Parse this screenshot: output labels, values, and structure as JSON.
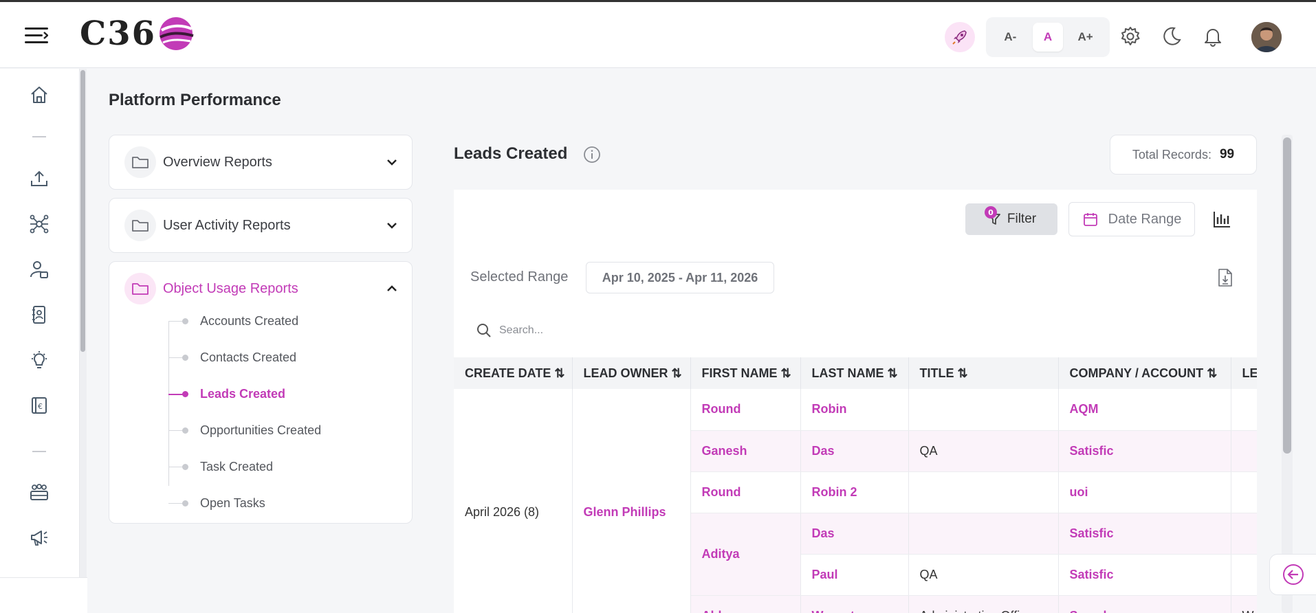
{
  "header": {
    "logo_text": "C36",
    "font_sizes": [
      "A-",
      "A",
      "A+"
    ],
    "active_font_size": "A"
  },
  "page": {
    "title": "Platform Performance"
  },
  "reports_menu": [
    {
      "label": "Overview Reports",
      "expanded": false
    },
    {
      "label": "User Activity Reports",
      "expanded": false
    },
    {
      "label": "Object Usage Reports",
      "expanded": true,
      "items": [
        {
          "label": "Accounts Created",
          "active": false
        },
        {
          "label": "Contacts Created",
          "active": false
        },
        {
          "label": "Leads Created",
          "active": true
        },
        {
          "label": "Opportunities Created",
          "active": false
        },
        {
          "label": "Task Created",
          "active": false
        },
        {
          "label": "Open Tasks",
          "active": false
        }
      ]
    }
  ],
  "report": {
    "title": "Leads Created",
    "total_label": "Total Records:",
    "total_value": "99",
    "filter_label": "Filter",
    "filter_count": "0",
    "date_range_label": "Date Range",
    "selected_range_label": "Selected Range",
    "selected_range_value": "Apr 10, 2025 - Apr 11, 2026",
    "search_placeholder": "Search..."
  },
  "table": {
    "columns": [
      "CREATE DATE",
      "LEAD OWNER",
      "FIRST NAME",
      "LAST NAME",
      "TITLE",
      "COMPANY / ACCOUNT",
      "LE"
    ],
    "group": {
      "create_date": "April 2026 (8)",
      "lead_owner": "Glenn Phillips"
    },
    "rows": [
      {
        "first_name": "Round",
        "last_name": "Robin",
        "title": "",
        "company": "AQM",
        "extra": ""
      },
      {
        "first_name": "Ganesh",
        "last_name": "Das",
        "title": "QA",
        "company": "Satisfic",
        "extra": ""
      },
      {
        "first_name": "Round",
        "last_name": "Robin 2",
        "title": "",
        "company": "uoi",
        "extra": ""
      },
      {
        "first_name": "Aditya",
        "last_name": "Das",
        "title": "",
        "company": "Satisfic",
        "extra": ""
      },
      {
        "first_name": "",
        "last_name": "Paul",
        "title": "QA",
        "company": "Satisfic",
        "extra": ""
      },
      {
        "first_name": "Abhe",
        "last_name": "Waveet",
        "title": "Administrative Officer",
        "company": "Sample",
        "extra": "W"
      }
    ]
  },
  "colors": {
    "accent": "#c23bb7",
    "accent_light": "#fbe6f6",
    "header_bg": "#ffffff",
    "page_bg": "#f5f6f8"
  }
}
